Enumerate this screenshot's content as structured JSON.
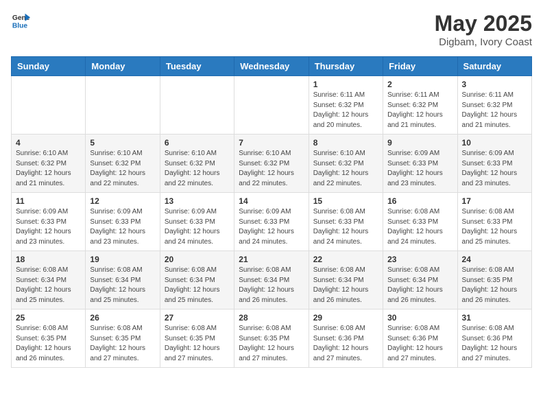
{
  "header": {
    "logo_general": "General",
    "logo_blue": "Blue",
    "month_year": "May 2025",
    "location": "Digbam, Ivory Coast"
  },
  "days_of_week": [
    "Sunday",
    "Monday",
    "Tuesday",
    "Wednesday",
    "Thursday",
    "Friday",
    "Saturday"
  ],
  "weeks": [
    [
      {
        "day": "",
        "info": ""
      },
      {
        "day": "",
        "info": ""
      },
      {
        "day": "",
        "info": ""
      },
      {
        "day": "",
        "info": ""
      },
      {
        "day": "1",
        "info": "Sunrise: 6:11 AM\nSunset: 6:32 PM\nDaylight: 12 hours\nand 20 minutes."
      },
      {
        "day": "2",
        "info": "Sunrise: 6:11 AM\nSunset: 6:32 PM\nDaylight: 12 hours\nand 21 minutes."
      },
      {
        "day": "3",
        "info": "Sunrise: 6:11 AM\nSunset: 6:32 PM\nDaylight: 12 hours\nand 21 minutes."
      }
    ],
    [
      {
        "day": "4",
        "info": "Sunrise: 6:10 AM\nSunset: 6:32 PM\nDaylight: 12 hours\nand 21 minutes."
      },
      {
        "day": "5",
        "info": "Sunrise: 6:10 AM\nSunset: 6:32 PM\nDaylight: 12 hours\nand 22 minutes."
      },
      {
        "day": "6",
        "info": "Sunrise: 6:10 AM\nSunset: 6:32 PM\nDaylight: 12 hours\nand 22 minutes."
      },
      {
        "day": "7",
        "info": "Sunrise: 6:10 AM\nSunset: 6:32 PM\nDaylight: 12 hours\nand 22 minutes."
      },
      {
        "day": "8",
        "info": "Sunrise: 6:10 AM\nSunset: 6:32 PM\nDaylight: 12 hours\nand 22 minutes."
      },
      {
        "day": "9",
        "info": "Sunrise: 6:09 AM\nSunset: 6:33 PM\nDaylight: 12 hours\nand 23 minutes."
      },
      {
        "day": "10",
        "info": "Sunrise: 6:09 AM\nSunset: 6:33 PM\nDaylight: 12 hours\nand 23 minutes."
      }
    ],
    [
      {
        "day": "11",
        "info": "Sunrise: 6:09 AM\nSunset: 6:33 PM\nDaylight: 12 hours\nand 23 minutes."
      },
      {
        "day": "12",
        "info": "Sunrise: 6:09 AM\nSunset: 6:33 PM\nDaylight: 12 hours\nand 23 minutes."
      },
      {
        "day": "13",
        "info": "Sunrise: 6:09 AM\nSunset: 6:33 PM\nDaylight: 12 hours\nand 24 minutes."
      },
      {
        "day": "14",
        "info": "Sunrise: 6:09 AM\nSunset: 6:33 PM\nDaylight: 12 hours\nand 24 minutes."
      },
      {
        "day": "15",
        "info": "Sunrise: 6:08 AM\nSunset: 6:33 PM\nDaylight: 12 hours\nand 24 minutes."
      },
      {
        "day": "16",
        "info": "Sunrise: 6:08 AM\nSunset: 6:33 PM\nDaylight: 12 hours\nand 24 minutes."
      },
      {
        "day": "17",
        "info": "Sunrise: 6:08 AM\nSunset: 6:33 PM\nDaylight: 12 hours\nand 25 minutes."
      }
    ],
    [
      {
        "day": "18",
        "info": "Sunrise: 6:08 AM\nSunset: 6:34 PM\nDaylight: 12 hours\nand 25 minutes."
      },
      {
        "day": "19",
        "info": "Sunrise: 6:08 AM\nSunset: 6:34 PM\nDaylight: 12 hours\nand 25 minutes."
      },
      {
        "day": "20",
        "info": "Sunrise: 6:08 AM\nSunset: 6:34 PM\nDaylight: 12 hours\nand 25 minutes."
      },
      {
        "day": "21",
        "info": "Sunrise: 6:08 AM\nSunset: 6:34 PM\nDaylight: 12 hours\nand 26 minutes."
      },
      {
        "day": "22",
        "info": "Sunrise: 6:08 AM\nSunset: 6:34 PM\nDaylight: 12 hours\nand 26 minutes."
      },
      {
        "day": "23",
        "info": "Sunrise: 6:08 AM\nSunset: 6:34 PM\nDaylight: 12 hours\nand 26 minutes."
      },
      {
        "day": "24",
        "info": "Sunrise: 6:08 AM\nSunset: 6:35 PM\nDaylight: 12 hours\nand 26 minutes."
      }
    ],
    [
      {
        "day": "25",
        "info": "Sunrise: 6:08 AM\nSunset: 6:35 PM\nDaylight: 12 hours\nand 26 minutes."
      },
      {
        "day": "26",
        "info": "Sunrise: 6:08 AM\nSunset: 6:35 PM\nDaylight: 12 hours\nand 27 minutes."
      },
      {
        "day": "27",
        "info": "Sunrise: 6:08 AM\nSunset: 6:35 PM\nDaylight: 12 hours\nand 27 minutes."
      },
      {
        "day": "28",
        "info": "Sunrise: 6:08 AM\nSunset: 6:35 PM\nDaylight: 12 hours\nand 27 minutes."
      },
      {
        "day": "29",
        "info": "Sunrise: 6:08 AM\nSunset: 6:36 PM\nDaylight: 12 hours\nand 27 minutes."
      },
      {
        "day": "30",
        "info": "Sunrise: 6:08 AM\nSunset: 6:36 PM\nDaylight: 12 hours\nand 27 minutes."
      },
      {
        "day": "31",
        "info": "Sunrise: 6:08 AM\nSunset: 6:36 PM\nDaylight: 12 hours\nand 27 minutes."
      }
    ]
  ]
}
